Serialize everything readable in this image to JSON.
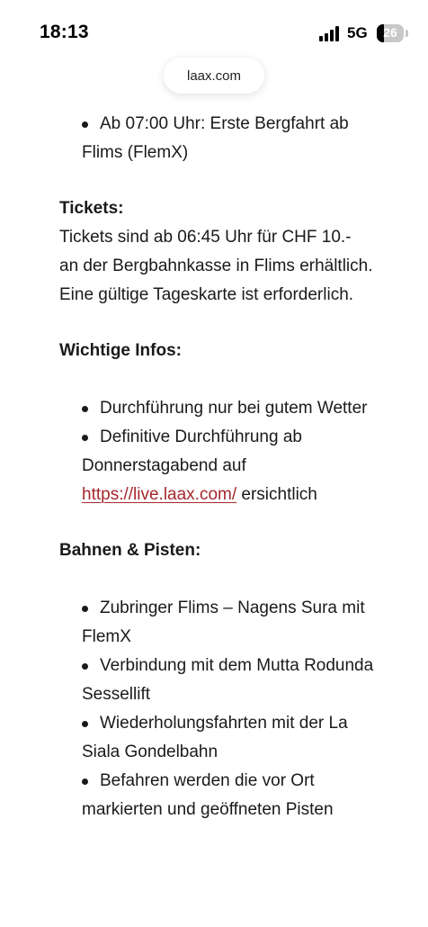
{
  "status_bar": {
    "time": "18:13",
    "network": "5G",
    "battery_level": "26"
  },
  "browser": {
    "url": "laax.com"
  },
  "content": {
    "schedule_items": [
      "Ab 07:00 Uhr: Erste Bergfahrt ab Flims (FlemX)"
    ],
    "tickets_heading": "Tickets:",
    "tickets_text": "Tickets sind ab 06:45 Uhr für CHF 10.- an der Bergbahnkasse in Flims erhältlich. Eine gültige Tageskarte ist erforderlich.",
    "infos_heading": "Wichtige Infos:",
    "infos_item_1": "Durchführung nur bei gutem Wetter",
    "infos_item_2_prefix": "Definitive Durchführung ab Donnerstagabend auf",
    "infos_item_2_link": "https://live.laax.com/",
    "infos_item_2_suffix": "ersichtlich",
    "lifts_heading": "Bahnen & Pisten:",
    "lifts_items": [
      "Zubringer Flims – Nagens Sura mit FlemX",
      "Verbindung mit dem Mutta Rodunda Sessellift",
      "Wiederholungsfahrten mit der La Siala Gondelbahn",
      "Befahren werden die vor Ort markierten und geöffneten Pisten"
    ]
  },
  "colors": {
    "link": "#a5282d",
    "text": "#1a1a1a"
  }
}
